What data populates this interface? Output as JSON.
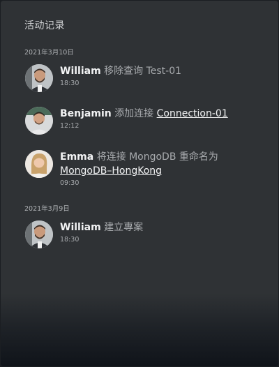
{
  "panel": {
    "title": "活动记录"
  },
  "groups": [
    {
      "date": "2021年3月10日",
      "entries": [
        {
          "user": "William",
          "action": "移除查询",
          "target": "Test-01",
          "target_is_link": false,
          "time": "18:30",
          "avatar": "avatar-william-icon"
        },
        {
          "user": "Benjamin",
          "action": "添加连接",
          "target": "Connection-01",
          "target_is_link": true,
          "time": "12:12",
          "avatar": "avatar-benjamin-icon"
        },
        {
          "user": "Emma",
          "action": "将连接 MongoDB 重命名为",
          "target": "MongoDB–HongKong",
          "target_is_link": true,
          "time": "09:30",
          "avatar": "avatar-emma-icon"
        }
      ]
    },
    {
      "date": "2021年3月9日",
      "entries": [
        {
          "user": "William",
          "action": "建立專案",
          "target": "",
          "target_is_link": false,
          "time": "18:30",
          "avatar": "avatar-william-icon"
        }
      ]
    }
  ],
  "colors": {
    "background": "#2f3235",
    "name_text": "#f2f3f4",
    "muted_text": "#a8abae"
  }
}
